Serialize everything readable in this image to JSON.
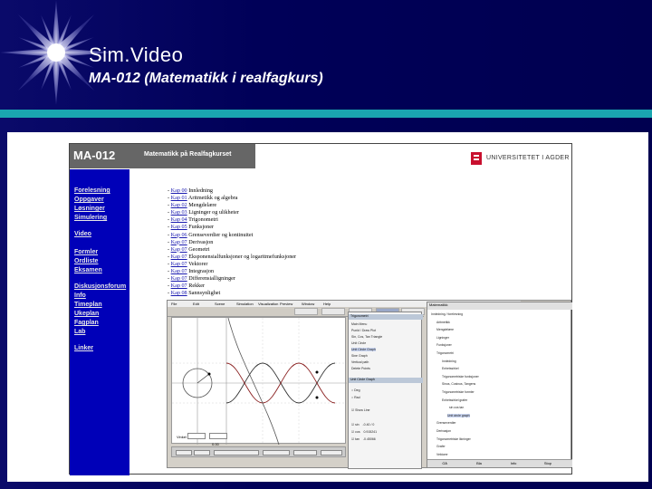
{
  "slide": {
    "title": "Sim.Video",
    "subtitle": "MA-012 (Matematikk i realfagkurs)"
  },
  "site": {
    "code": "MA-012",
    "header_title": "Matematikk på Realfagkurset",
    "logo_text": "UNIVERSITETET I AGDER",
    "sidebar": [
      {
        "label": "Forelesning"
      },
      {
        "label": "Oppgaver"
      },
      {
        "label": "Løsninger"
      },
      {
        "label": "Simulering"
      },
      {
        "label": "Video"
      },
      {
        "label": "Formler"
      },
      {
        "label": "Ordliste"
      },
      {
        "label": "Eksamen"
      },
      {
        "label": "Diskusjonsforum"
      },
      {
        "label": "Info"
      },
      {
        "label": "Timeplan"
      },
      {
        "label": "Ukeplan"
      },
      {
        "label": "Fagplan"
      },
      {
        "label": "Lab"
      },
      {
        "label": "Linker"
      }
    ],
    "chapters": [
      {
        "num": "Kap 00",
        "title": "Innledning"
      },
      {
        "num": "Kap 01",
        "title": "Aritmetikk og algebra"
      },
      {
        "num": "Kap 02",
        "title": "Mengdelære"
      },
      {
        "num": "Kap 03",
        "title": "Ligninger og ulikheter"
      },
      {
        "num": "Kap 04",
        "title": "Trigonometri"
      },
      {
        "num": "Kap 05",
        "title": "Funksjoner"
      },
      {
        "num": "Kap 06",
        "title": "Grenseverdier og kontinuitet"
      },
      {
        "num": "Kap 07",
        "title": "Derivasjon"
      },
      {
        "num": "Kap 07",
        "title": "Geometri"
      },
      {
        "num": "Kap 07",
        "title": "Eksponensialfunksjoner og logaritmefunksjoner"
      },
      {
        "num": "Kap 07",
        "title": "Vektorer"
      },
      {
        "num": "Kap 07",
        "title": "Integrasjon"
      },
      {
        "num": "Kap 07",
        "title": "Differensialligninger"
      },
      {
        "num": "Kap 07",
        "title": "Rekker"
      },
      {
        "num": "Kap 08",
        "title": "Sannsynlighet"
      }
    ]
  },
  "app": {
    "menu": [
      "File",
      "Edit",
      "Scene",
      "Simulation",
      "Visualization",
      "Preview",
      "Window",
      "Help"
    ],
    "props_title": "Trigonometri",
    "props_items": [
      "Main Menu",
      "Punkt / Draw Plot",
      "Sin, Cos, Tan Triangle",
      "Unit Circle",
      "Unit Circle Graph",
      "Sine Graph",
      "Vertical path",
      "Delete Points"
    ],
    "props_sub_title": "Unit Circle Graph",
    "props_options": [
      "Deg",
      "Rad",
      "Show Line"
    ],
    "props_values": [
      {
        "label": "sin",
        "value": "-0.40 / 0"
      },
      {
        "label": "cos",
        "value": "0.915241"
      },
      {
        "label": "tan",
        "value": "-0.45066"
      }
    ],
    "angle_label": "Vinkel",
    "angle_value": "0.00",
    "tree_title": "Matematikk",
    "tree_items": [
      "Innledning / forelesning",
      "Aritmetikk",
      "Mengdelære",
      "Ligninger",
      "Funksjoner",
      "Trigonometri",
      "Innledning",
      "Enhetssirkel",
      "Trigonometriske funksjoner",
      "Sinus, Cosinus, Tangens",
      "Trigonometriske formler",
      "Enhetssirkel grafer",
      "sin  cos  tan",
      "Unit circle graph",
      "Grenseverdier",
      "Derivasjon",
      "Trigonometriske likninger",
      "Grafer",
      "Vektorer"
    ],
    "tree_footer": [
      "Gå",
      "Bla",
      "Info",
      "Stop"
    ]
  },
  "colors": {
    "sidebar": "#0000b8",
    "accent": "#1aa6b0",
    "slide_bg": "#00005a"
  }
}
